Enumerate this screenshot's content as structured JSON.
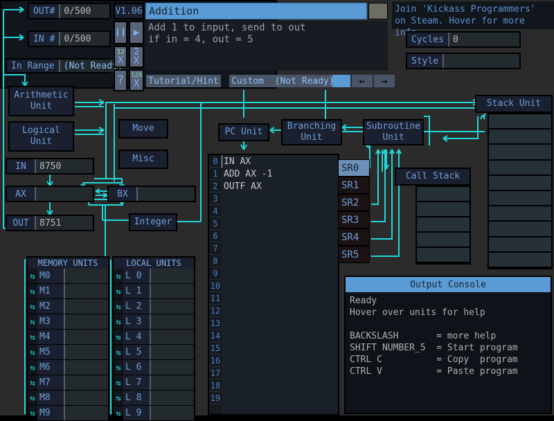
{
  "meta": {
    "version": "V1.06",
    "accent": "#22d7d7",
    "blue": "#5b9bd5",
    "text_blue": "#6f9fd8"
  },
  "counters": {
    "out_label": "OUT#",
    "out_value": "0/500",
    "in_label": "IN #",
    "in_value": "0/500",
    "range_label": "In Range",
    "range_value": "(Not Ready)"
  },
  "program": {
    "title": "Addition",
    "description": "Add 1 to input, send to out\nif in = 4, out = 5",
    "tutorial_label": "Tutorial/Hint",
    "custom_label": "Custom  (Not Ready)",
    "prev_label": "←",
    "next_label": "→"
  },
  "toolbuttons": [
    {
      "name": "pause-button",
      "glyph": "❙❙",
      "badge": ""
    },
    {
      "name": "play-button",
      "glyph": "▶",
      "badge": ""
    },
    {
      "name": "speed-32x",
      "glyph": "X",
      "badge": "32"
    },
    {
      "name": "speed-2x",
      "glyph": "X",
      "badge": "2"
    },
    {
      "name": "help-button",
      "glyph": "?",
      "badge": ""
    },
    {
      "name": "speed-128x",
      "glyph": "X",
      "badge": "128"
    }
  ],
  "promo": "Join 'Kickass Programmers'\non Steam. Hover for more info",
  "stats": [
    {
      "label": "Cycles",
      "value": "0"
    },
    {
      "label": "Style",
      "value": ""
    }
  ],
  "units": {
    "arithmetic": "Arithmetic\nUnit",
    "logical": "Logical\nUnit",
    "move": "Move",
    "misc": "Misc",
    "integer": "Integer",
    "pc": "PC Unit",
    "branching": "Branching\nUnit",
    "subroutine": "Subroutine\nUnit",
    "call_stack": "Call Stack",
    "stack_unit": "Stack Unit"
  },
  "registers": [
    {
      "label": "IN",
      "value": "8750"
    },
    {
      "label": "AX",
      "value": ""
    },
    {
      "label": "BX",
      "value": ""
    },
    {
      "label": "OUT",
      "value": "8751"
    }
  ],
  "code": {
    "lines": [
      "IN AX",
      "ADD AX -1",
      "OUTF AX"
    ],
    "line_numbers": [
      "0",
      "1",
      "2",
      "3",
      "4",
      "5",
      "6",
      "7",
      "8",
      "9",
      "10",
      "11",
      "12",
      "13",
      "14",
      "15",
      "16",
      "17",
      "18",
      "19"
    ],
    "cursor_line": 0
  },
  "subroutines": {
    "items": [
      "SR0",
      "SR1",
      "SR2",
      "SR3",
      "SR4",
      "SR5"
    ],
    "selected": "SR0"
  },
  "stack_unit": {
    "rows": [
      "",
      "",
      "",
      "",
      "",
      "",
      "",
      "",
      "",
      ""
    ]
  },
  "call_stack": {
    "rows": [
      "",
      "",
      "",
      "",
      ""
    ]
  },
  "memory_units": {
    "header": "MEMORY UNITS",
    "rows": [
      {
        "name": "M0",
        "value": ""
      },
      {
        "name": "M1",
        "value": ""
      },
      {
        "name": "M2",
        "value": ""
      },
      {
        "name": "M3",
        "value": ""
      },
      {
        "name": "M4",
        "value": ""
      },
      {
        "name": "M5",
        "value": ""
      },
      {
        "name": "M6",
        "value": ""
      },
      {
        "name": "M7",
        "value": ""
      },
      {
        "name": "M8",
        "value": ""
      },
      {
        "name": "M9",
        "value": ""
      }
    ]
  },
  "local_units": {
    "header": "LOCAL UNITS",
    "rows": [
      {
        "name": "L 0",
        "value": ""
      },
      {
        "name": "L 1",
        "value": ""
      },
      {
        "name": "L 2",
        "value": ""
      },
      {
        "name": "L 3",
        "value": ""
      },
      {
        "name": "L 4",
        "value": ""
      },
      {
        "name": "L 5",
        "value": ""
      },
      {
        "name": "L 6",
        "value": ""
      },
      {
        "name": "L 7",
        "value": ""
      },
      {
        "name": "L 8",
        "value": ""
      },
      {
        "name": "L 9",
        "value": ""
      }
    ]
  },
  "console": {
    "title": "Output Console",
    "body": "Ready\nHover over units for help\n\nBACKSLASH       = more help\nSHIFT NUMBER_5  = Start program\nCTRL C          = Copy  program\nCTRL V          = Paste program"
  }
}
